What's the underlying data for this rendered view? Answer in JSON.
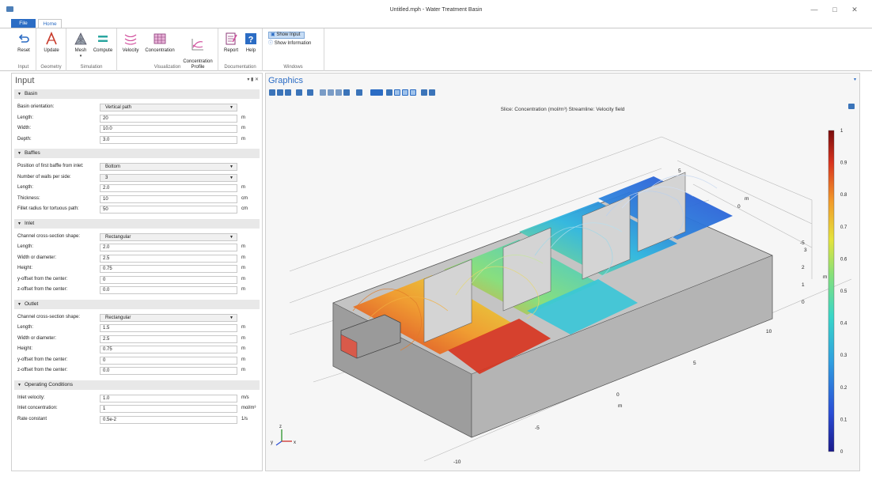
{
  "window": {
    "title": "Untitled.mph - Water Treatment Basin"
  },
  "ribbon": {
    "tabs": [
      "File",
      "Home"
    ],
    "groups": [
      {
        "label": "Input",
        "buttons": [
          "Reset"
        ]
      },
      {
        "label": "Geometry",
        "buttons": [
          "Update"
        ]
      },
      {
        "label": "Simulation",
        "buttons": [
          "Mesh",
          "Compute"
        ]
      },
      {
        "label": "Visualization",
        "buttons": [
          "Velocity",
          "Concentration",
          "Concentration\nProfile"
        ]
      },
      {
        "label": "Documentation",
        "buttons": [
          "Report",
          "Help"
        ]
      },
      {
        "label": "Windows",
        "buttons": [
          "Show Input",
          "Show Information"
        ]
      }
    ],
    "colors": {
      "accent": "#2b6cc4",
      "file_tab": "#2b6cc4"
    }
  },
  "input_panel": {
    "title": "Input",
    "sections": [
      {
        "title": "Basin",
        "fields": [
          {
            "label": "Basin orientation:",
            "type": "select",
            "value": "Vertical path",
            "unit": ""
          },
          {
            "label": "Length:",
            "type": "text",
            "value": "20",
            "unit": "m"
          },
          {
            "label": "Width:",
            "type": "text",
            "value": "10.0",
            "unit": "m"
          },
          {
            "label": "Depth:",
            "type": "text",
            "value": "3.0",
            "unit": "m"
          }
        ]
      },
      {
        "title": "Baffles",
        "fields": [
          {
            "label": "Position of first baffle from inlet:",
            "type": "select",
            "value": "Bottom",
            "unit": ""
          },
          {
            "label": "Number of walls per side:",
            "type": "select",
            "value": "3",
            "unit": ""
          },
          {
            "label": "Length:",
            "type": "text",
            "value": "2.0",
            "unit": "m"
          },
          {
            "label": "Thickness:",
            "type": "text",
            "value": "10",
            "unit": "cm"
          },
          {
            "label": "Fillet radius for tortuous path:",
            "type": "text",
            "value": "50",
            "unit": "cm"
          }
        ]
      },
      {
        "title": "Inlet",
        "fields": [
          {
            "label": "Channel cross-section shape:",
            "type": "select",
            "value": "Rectangular",
            "unit": ""
          },
          {
            "label": "Length:",
            "type": "text",
            "value": "2.0",
            "unit": "m"
          },
          {
            "label": "Width or diameter:",
            "type": "text",
            "value": "2.5",
            "unit": "m"
          },
          {
            "label": "Height:",
            "type": "text",
            "value": "0.75",
            "unit": "m"
          },
          {
            "label": "y-offset from the center:",
            "type": "text",
            "value": "0",
            "unit": "m"
          },
          {
            "label": "z-offset from the center:",
            "type": "text",
            "value": "0.0",
            "unit": "m"
          }
        ]
      },
      {
        "title": "Outlet",
        "fields": [
          {
            "label": "Channel cross-section shape:",
            "type": "select",
            "value": "Rectangular",
            "unit": ""
          },
          {
            "label": "Length:",
            "type": "text",
            "value": "1.5",
            "unit": "m"
          },
          {
            "label": "Width or diameter:",
            "type": "text",
            "value": "2.5",
            "unit": "m"
          },
          {
            "label": "Height:",
            "type": "text",
            "value": "0.75",
            "unit": "m"
          },
          {
            "label": "y-offset from the center:",
            "type": "text",
            "value": "0",
            "unit": "m"
          },
          {
            "label": "z-offset from the center:",
            "type": "text",
            "value": "0.0",
            "unit": "m"
          }
        ]
      },
      {
        "title": "Operating Conditions",
        "fields": [
          {
            "label": "Inlet velocity:",
            "type": "text",
            "value": "1.0",
            "unit": "m/s"
          },
          {
            "label": "Inlet concentration:",
            "type": "text",
            "value": "1",
            "unit": "mol/m³"
          },
          {
            "label": "Rate constant",
            "type": "text",
            "value": "0.5e-2",
            "unit": "1/s"
          }
        ]
      }
    ]
  },
  "graphics": {
    "title": "Graphics",
    "plot_title": "Slice: Concentration (mol/m³)  Streamline: Velocity field",
    "colorbar": {
      "ticks": [
        "1",
        "0.9",
        "0.8",
        "0.7",
        "0.6",
        "0.5",
        "0.4",
        "0.3",
        "0.2",
        "0.1",
        "0"
      ]
    },
    "axis_labels": {
      "x_ticks": [
        "-10",
        "-5",
        "0",
        "5",
        "10"
      ],
      "x_unit": "m",
      "y_ticks": [
        "5",
        "0",
        "-5"
      ],
      "y_unit": "m",
      "z_ticks": [
        "3",
        "2",
        "1",
        "0"
      ],
      "z_unit": "m"
    },
    "triad": {
      "x": "x",
      "y": "y",
      "z": "z"
    }
  }
}
